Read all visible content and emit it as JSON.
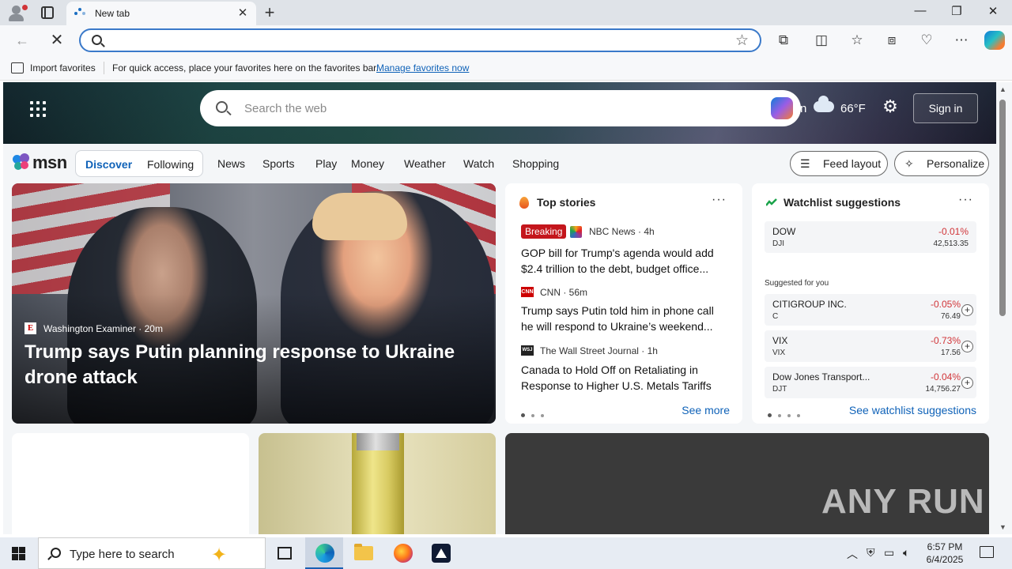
{
  "browser": {
    "tab_title": "New tab",
    "address_value": "",
    "favorites_bar": {
      "import_label": "Import favorites",
      "message": "For quick access, place your favorites here on the favorites bar.",
      "manage_link": "Manage favorites now"
    }
  },
  "msn": {
    "search_placeholder": "Search the web",
    "weather_partial": "n",
    "temperature": "66°F",
    "sign_in": "Sign in",
    "logo_text": "msn",
    "feed_tabs": [
      "Discover",
      "Following"
    ],
    "nav": [
      "News",
      "Sports",
      "Play",
      "Money",
      "Weather",
      "Watch",
      "Shopping"
    ],
    "feed_layout": "Feed layout",
    "personalize": "Personalize",
    "hero": {
      "source": "Washington Examiner",
      "age": "20m",
      "headline": "Trump says Putin planning response to Ukraine drone attack"
    },
    "top_stories": {
      "title": "Top stories",
      "breaking": "Breaking",
      "items": [
        {
          "source": "NBC News · 4h",
          "headline": "GOP bill for Trump's agenda would add $2.4 trillion to the debt, budget office..."
        },
        {
          "source": "CNN · 56m",
          "headline": "Trump says Putin told him in phone call he will respond to Ukraine’s weekend..."
        },
        {
          "source": "The Wall Street Journal · 1h",
          "headline": "Canada to Hold Off on Retaliating in Response to Higher U.S. Metals Tariffs"
        }
      ],
      "see_more": "See more"
    },
    "watchlist": {
      "title": "Watchlist suggestions",
      "suggested_label": "Suggested for you",
      "top": {
        "name": "DOW",
        "ticker": "DJI",
        "change": "-0.01%",
        "price": "42,513.35"
      },
      "rows": [
        {
          "name": "CITIGROUP INC.",
          "ticker": "C",
          "change": "-0.05%",
          "price": "76.49"
        },
        {
          "name": "VIX",
          "ticker": "VIX",
          "change": "-0.73%",
          "price": "17.56"
        },
        {
          "name": "Dow Jones Transport...",
          "ticker": "DJT",
          "change": "-0.04%",
          "price": "14,756.27"
        }
      ],
      "see_link": "See watchlist suggestions"
    },
    "watermark": "ANY RUN"
  },
  "taskbar": {
    "search_placeholder": "Type here to search",
    "time": "6:57 PM",
    "date": "6/4/2025"
  },
  "colors": {
    "accent_blue": "#0f62b8",
    "negative_red": "#d13438",
    "breaking_red": "#c4161c"
  }
}
